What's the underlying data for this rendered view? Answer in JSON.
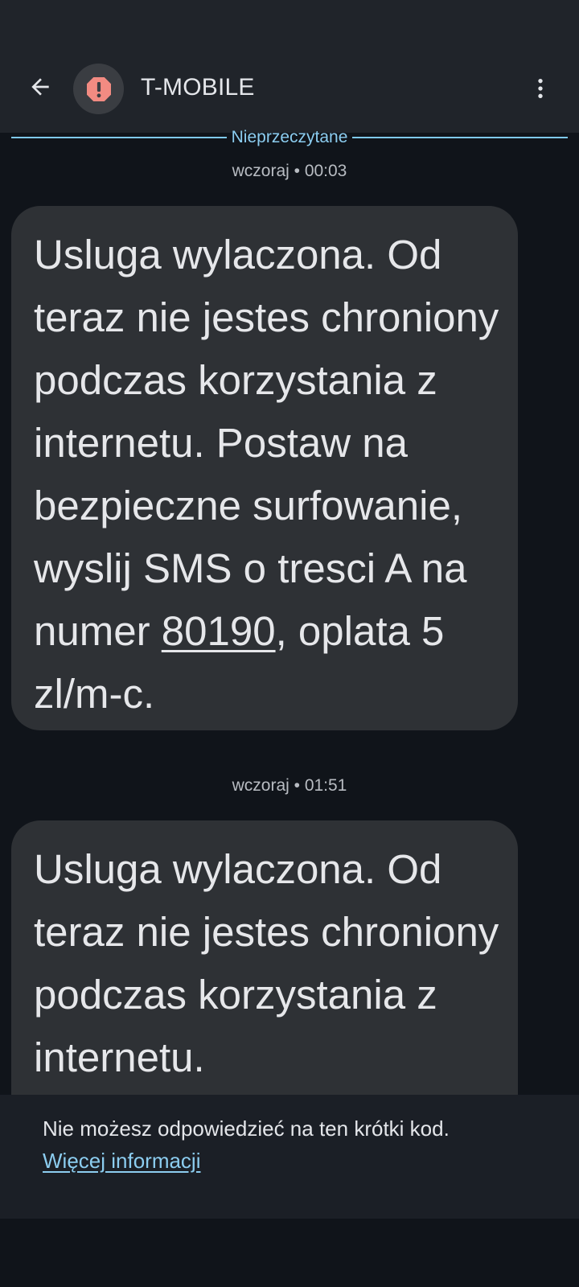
{
  "header": {
    "contact_name": "T-MOBILE",
    "back_icon": "arrow-left-icon",
    "avatar_icon": "alert-octagon-icon",
    "menu_icon": "more-vertical-icon",
    "avatar_badge_color": "#f28b82"
  },
  "conversation": {
    "unread_divider_label": "Nieprzeczytane",
    "messages": [
      {
        "timestamp": "wczoraj • 00:03",
        "text_before_link": "Usluga wylaczona. Od teraz nie jestes chroniony podczas korzystania z internetu. Postaw na bezpieczne surfowanie,  wyslij SMS o tresci A na numer ",
        "link_number": "80190",
        "text_after_link": ", oplata 5 zl/m-c."
      },
      {
        "timestamp": "wczoraj • 01:51",
        "text_before_link": "Usluga wylaczona. Od teraz nie jestes chroniony podczas korzystania z internetu.",
        "link_number": "",
        "text_after_link": ""
      }
    ]
  },
  "footer": {
    "notice": "Nie możesz odpowiedzieć na ten krótki kod.",
    "more_info_link": "Więcej informacji"
  },
  "colors": {
    "background": "#10141a",
    "bubble": "#2e3135",
    "accent": "#8ccdf0"
  }
}
